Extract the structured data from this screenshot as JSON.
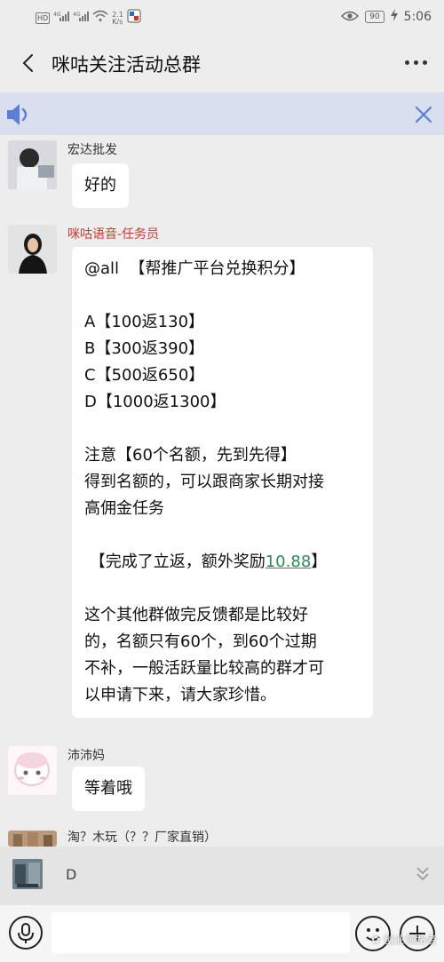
{
  "status_bar": {
    "left_badges": [
      "HD",
      "4G",
      "4G"
    ],
    "net_speed": "2.1\nK/s",
    "battery": "90",
    "time": "5:06"
  },
  "header": {
    "title": "咪咕关注活动总群"
  },
  "messages": [
    {
      "sender": "宏达批发",
      "text": "好的"
    },
    {
      "sender": "咪咕语音-任务员",
      "text_before_link": "@all  【帮推广平台兑换积分】\n\nA【100返130】\nB【300返390】\nC【500返650】\nD【1000返1300】\n\n注意【60个名额，先到先得】\n得到名额的，可以跟商家长期对接\n高佣金任务\n\n 【完成了立返，额外奖励",
      "link": "10.88",
      "text_after_link": "】\n\n这个其他群做完反馈都是比较好\n的，名额只有60个，到60个过期\n不补，一般活跃量比较高的群才可\n以申请下来，请大家珍惜。"
    },
    {
      "sender": "沛沛妈",
      "text": "等着哦"
    },
    {
      "sender": "淘？木玩（？？厂家直销）"
    }
  ],
  "quote": {
    "text": "D"
  },
  "input": {
    "value": ""
  },
  "watermark": "创业领路者",
  "colors": {
    "background": "#ededed",
    "notice_bar": "#d9dfee",
    "accent_blue": "#5b7fd6",
    "sender_red": "#d4372c",
    "link_green": "#2e8b57"
  }
}
